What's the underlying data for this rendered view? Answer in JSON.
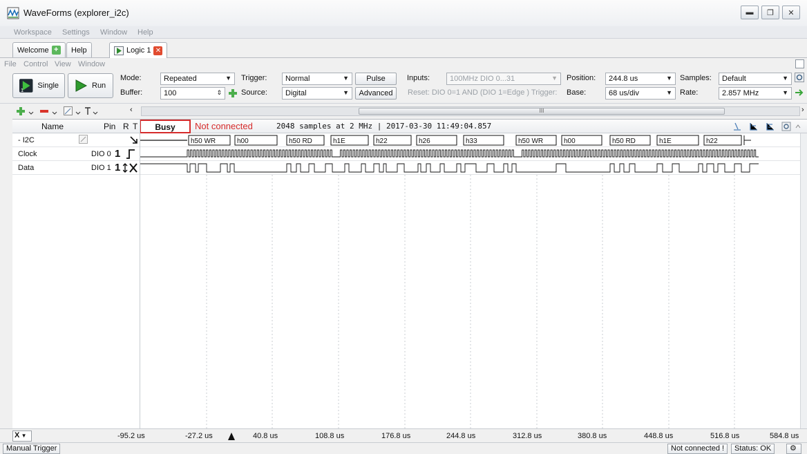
{
  "window": {
    "title": "WaveForms  (explorer_i2c)"
  },
  "menu": {
    "items": [
      "Workspace",
      "Settings",
      "Window",
      "Help"
    ]
  },
  "tabs": [
    {
      "label": "Welcome"
    },
    {
      "label": "Help"
    },
    {
      "label": "Logic 1"
    }
  ],
  "logic_menu": {
    "items": [
      "File",
      "Control",
      "View",
      "Window"
    ]
  },
  "toolbar": {
    "single_label": "Single",
    "run_label": "Run",
    "mode_label": "Mode:",
    "mode_value": "Repeated",
    "buffer_label": "Buffer:",
    "buffer_value": "100",
    "trigger_label": "Trigger:",
    "trigger_value": "Normal",
    "source_label": "Source:",
    "source_value": "Digital",
    "pulse_label": "Pulse",
    "advanced_label": "Advanced",
    "inputs_label": "Inputs:",
    "inputs_value": "100MHz DIO 0...31",
    "reset_text": "Reset: DIO 0=1 AND (DIO 1=Edge ) Trigger:",
    "position_label": "Position:",
    "position_value": "244.8 us",
    "base_label": "Base:",
    "base_value": "68 us/div",
    "samples_label": "Samples:",
    "samples_value": "Default",
    "rate_label": "Rate:",
    "rate_value": "2.857 MHz"
  },
  "scroll": {
    "thumb_text": "III"
  },
  "table": {
    "col_name": "Name",
    "col_pin": "Pin",
    "col_r": "R",
    "col_t": "T",
    "busy_label": "Busy",
    "status_text": "Not connected",
    "info_text": "2048 samples at 2 MHz | 2017-03-30 11:49:04.857",
    "rows": [
      {
        "name": "- I2C",
        "pin": ""
      },
      {
        "name": "Clock",
        "pin": "DIO 0",
        "r": "1"
      },
      {
        "name": "Data",
        "pin": "DIO 1",
        "r": "1"
      }
    ],
    "bus_labels": [
      "h50 WR",
      "h00",
      "h50 RD",
      "h1E",
      "h22",
      "h26",
      "h33",
      "h50 WR",
      "h00",
      "h50 RD",
      "h1E",
      "h22"
    ]
  },
  "time_axis": {
    "ticks": [
      "-95.2 us",
      "-27.2 us",
      "40.8 us",
      "108.8 us",
      "176.8 us",
      "244.8 us",
      "312.8 us",
      "380.8 us",
      "448.8 us",
      "516.8 us",
      "584.8 us"
    ],
    "x_label": "X"
  },
  "statusbar": {
    "manual_trigger": "Manual Trigger",
    "not_connected": "Not connected !",
    "status": "Status: OK"
  },
  "colors": {
    "accent_red": "#d62b2b",
    "plus_green": "#5cb85c",
    "close_red": "#e14b2f"
  }
}
